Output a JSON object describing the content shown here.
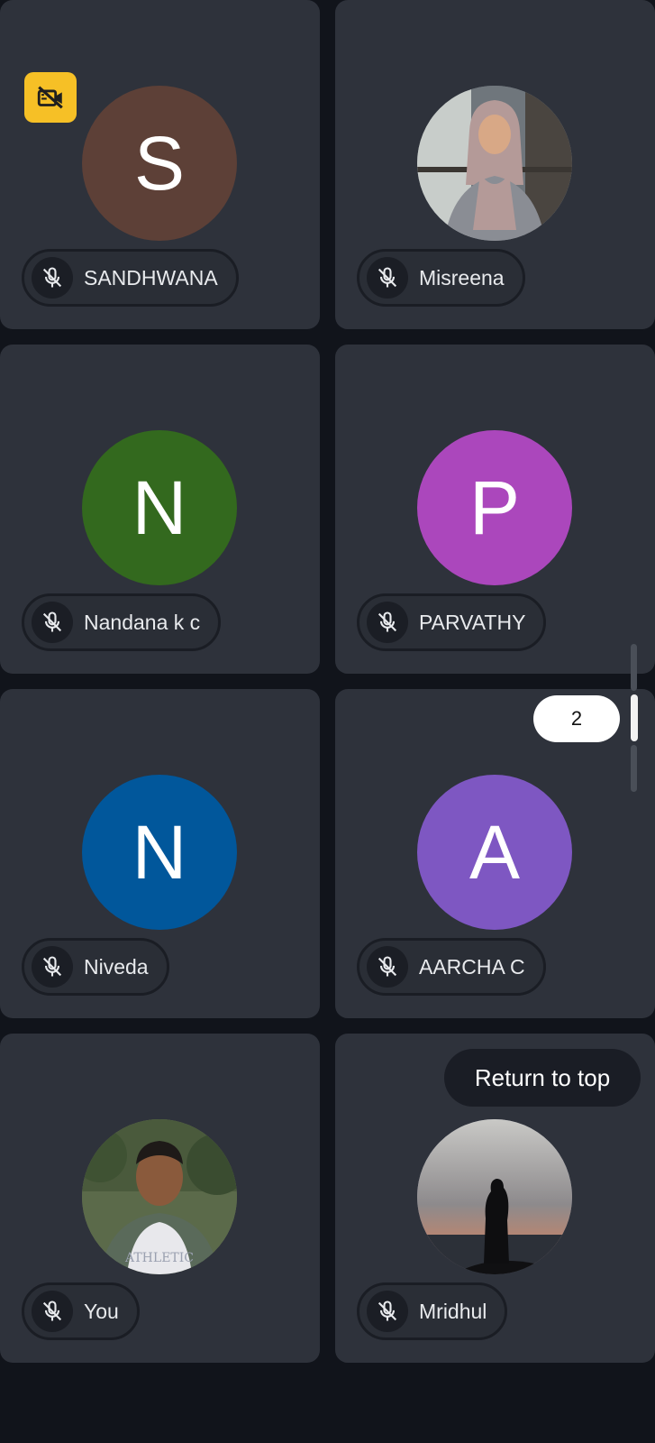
{
  "participants": [
    {
      "name": "SANDHWANA",
      "initial": "S",
      "avatar_color": "#5d4037",
      "muted": true
    },
    {
      "name": "Misreena",
      "initial": "",
      "avatar_color": "#7a8088",
      "muted": true
    },
    {
      "name": "Nandana k c",
      "initial": "N",
      "avatar_color": "#33691e",
      "muted": true
    },
    {
      "name": "PARVATHY",
      "initial": "P",
      "avatar_color": "#ab47bc",
      "muted": true
    },
    {
      "name": "Niveda",
      "initial": "N",
      "avatar_color": "#01579b",
      "muted": true
    },
    {
      "name": "AARCHA C",
      "initial": "A",
      "avatar_color": "#7e57c2",
      "muted": true
    },
    {
      "name": "You",
      "initial": "",
      "avatar_color": "#6d7a5a",
      "muted": true
    },
    {
      "name": "Mridhul",
      "initial": "",
      "avatar_color": "#8a8aa0",
      "muted": true
    }
  ],
  "icons": {
    "mic": "mic-off-icon",
    "badge": "video-off-icon"
  },
  "pagination": {
    "page": "2"
  },
  "return_to_top": {
    "label": "Return to top"
  },
  "colors": {
    "background": "#11141b",
    "tile": "#2e323b",
    "badge": "#f6c026"
  }
}
